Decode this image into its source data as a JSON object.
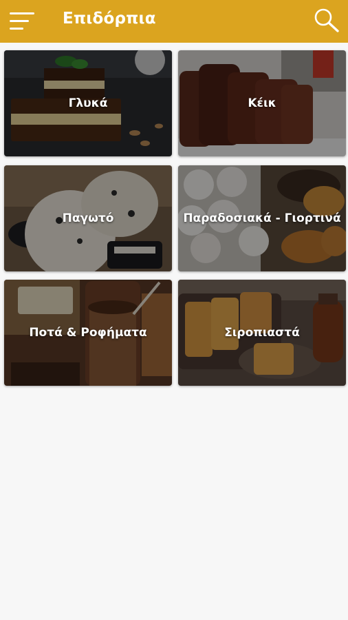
{
  "header": {
    "title": "Επιδόρπια",
    "menu_icon": "menu-icon",
    "search_icon": "search-icon",
    "background": "#dba41f"
  },
  "categories": [
    {
      "label": "Γλυκά"
    },
    {
      "label": "Κέικ"
    },
    {
      "label": "Παγωτό"
    },
    {
      "label": "Παραδοσιακά - Γιορτινά"
    },
    {
      "label": "Ποτά & Ροφήματα"
    },
    {
      "label": "Σιροπιαστά"
    }
  ]
}
